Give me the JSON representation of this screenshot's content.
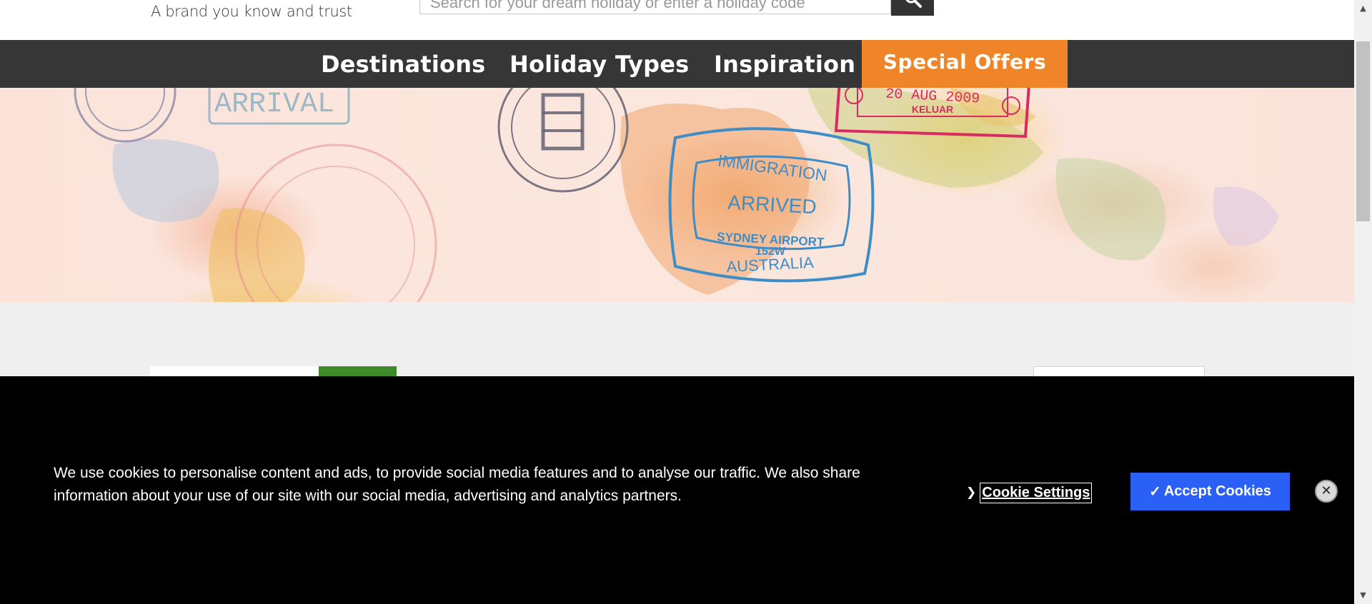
{
  "header": {
    "tagline": "A brand you know and trust",
    "search": {
      "placeholder": "Search for your dream holiday or enter a holiday code",
      "icon": "search-icon"
    }
  },
  "nav": {
    "items": [
      {
        "label": "Destinations"
      },
      {
        "label": "Holiday Types"
      },
      {
        "label": "Inspiration"
      }
    ],
    "special_offers": "Special Offers",
    "special_offers_color": "#f08429"
  },
  "hero": {
    "stamps": {
      "immigration": {
        "top": "IMMIGRATION",
        "center": "ARRIVED",
        "line1": "SYDNEY AIRPORT",
        "line2": "152W",
        "bottom": "AUSTRALIA"
      },
      "arrival": "ARRIVAL",
      "keluar_date": "20 AUG 2009",
      "keluar": "KELUAR"
    }
  },
  "cookie_banner": {
    "text": "We use cookies to personalise content and ads, to provide social media features and to analyse our traffic. We also share information about your use of our site with our social media, advertising and analytics partners.",
    "settings_label": "Cookie Settings",
    "settings_icon": "chevron-right-icon",
    "accept_check": "✓",
    "accept_label": "Accept Cookies",
    "accept_color": "#2b60f6",
    "close_icon": "close-icon"
  }
}
